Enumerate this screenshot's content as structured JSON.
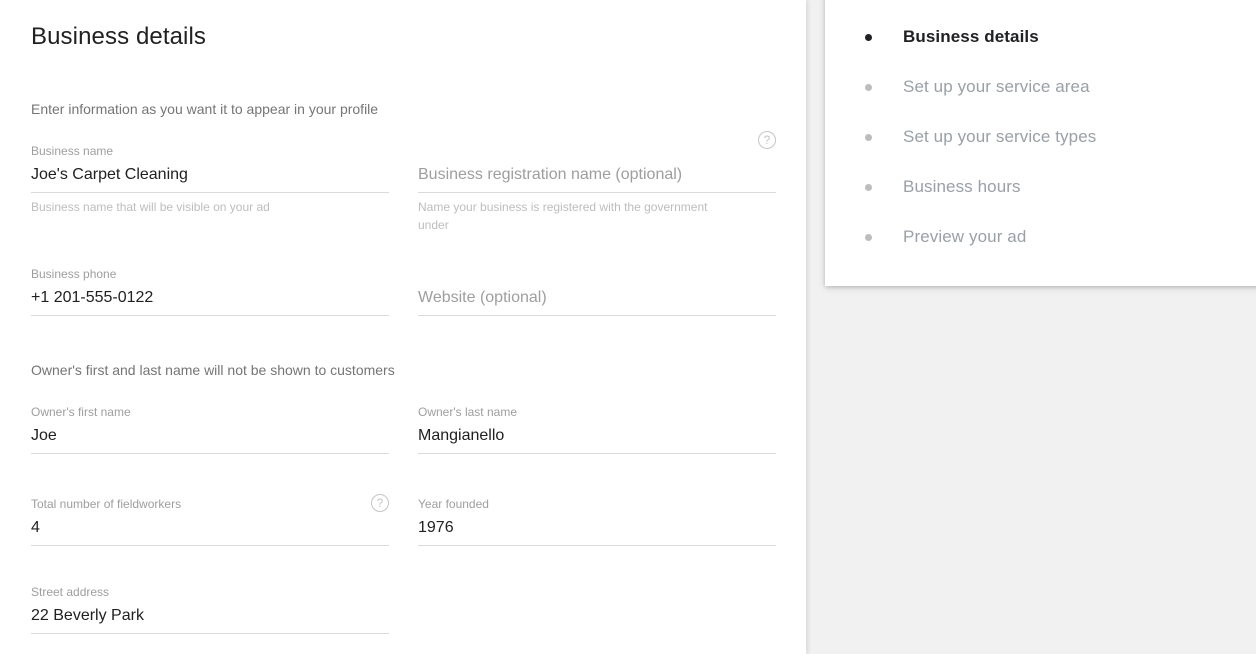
{
  "main": {
    "title": "Business details",
    "intro_caption": "Enter information as you want it to appear in your profile",
    "owner_caption": "Owner's first and last name will not be shown to customers",
    "help_icon": "help-circle-icon",
    "fields": {
      "business_name": {
        "label": "Business name",
        "value": "Joe's Carpet Cleaning",
        "hint": "Business name that will be visible on your ad"
      },
      "business_registration_name": {
        "label": "",
        "placeholder": "Business registration name (optional)",
        "value": "",
        "hint": "Name your business is registered with the government under"
      },
      "business_phone": {
        "label": "Business phone",
        "value": "+1 201-555-0122",
        "hint": ""
      },
      "website": {
        "label": "",
        "placeholder": "Website (optional)",
        "value": "",
        "hint": ""
      },
      "owner_first_name": {
        "label": "Owner's first name",
        "value": "Joe",
        "hint": ""
      },
      "owner_last_name": {
        "label": "Owner's last name",
        "value": "Mangianello",
        "hint": ""
      },
      "fieldworkers": {
        "label": "Total number of fieldworkers",
        "value": "4",
        "hint": ""
      },
      "year_founded": {
        "label": "Year founded",
        "value": "1976",
        "hint": ""
      },
      "street_address": {
        "label": "Street address",
        "value": "22 Beverly Park",
        "hint": ""
      }
    }
  },
  "steps": {
    "items": [
      {
        "label": "Business details",
        "active": true
      },
      {
        "label": "Set up your service area",
        "active": false
      },
      {
        "label": "Set up your service types",
        "active": false
      },
      {
        "label": "Business hours",
        "active": false
      },
      {
        "label": "Preview your ad",
        "active": false
      }
    ]
  },
  "colors": {
    "page_background": "#f1f1f1",
    "panel_background": "#ffffff",
    "text_primary": "#212121",
    "text_secondary": "#757575",
    "text_muted": "#9e9e9e",
    "underline": "#dadada"
  }
}
